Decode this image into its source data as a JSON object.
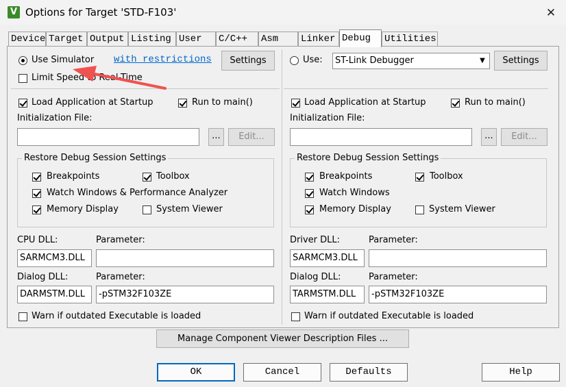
{
  "window": {
    "title": "Options for Target 'STD-F103'",
    "app_icon_letter": "V",
    "close_glyph": "✕"
  },
  "tabs": [
    "Device",
    "Target",
    "Output",
    "Listing",
    "User",
    "C/C++",
    "Asm",
    "Linker",
    "Debug",
    "Utilities"
  ],
  "active_tab": "Debug",
  "left": {
    "use_simulator": "Use Simulator",
    "restrictions_link": "with restrictions",
    "settings": "Settings",
    "limit_speed": "Limit Speed to Real-Time",
    "load_app": "Load Application at Startup",
    "run_to_main": "Run to main()",
    "init_file_label": "Initialization File:",
    "init_file_value": "",
    "browse": "...",
    "edit": "Edit...",
    "restore_group": "Restore Debug Session Settings",
    "breakpoints": "Breakpoints",
    "toolbox": "Toolbox",
    "watch": "Watch Windows & Performance Analyzer",
    "memory": "Memory Display",
    "system_viewer": "System Viewer",
    "cpu_dll_label": "CPU DLL:",
    "cpu_dll_value": "SARMCM3.DLL",
    "cpu_param_label": "Parameter:",
    "cpu_param_value": "",
    "dialog_dll_label": "Dialog DLL:",
    "dialog_dll_value": "DARMSTM.DLL",
    "dialog_param_label": "Parameter:",
    "dialog_param_value": "-pSTM32F103ZE",
    "warn": "Warn if outdated Executable is loaded"
  },
  "right": {
    "use": "Use:",
    "debugger": "ST-Link Debugger",
    "settings": "Settings",
    "load_app": "Load Application at Startup",
    "run_to_main": "Run to main()",
    "init_file_label": "Initialization File:",
    "init_file_value": "",
    "browse": "...",
    "edit": "Edit...",
    "restore_group": "Restore Debug Session Settings",
    "breakpoints": "Breakpoints",
    "toolbox": "Toolbox",
    "watch": "Watch Windows",
    "memory": "Memory Display",
    "system_viewer": "System Viewer",
    "driver_dll_label": "Driver DLL:",
    "driver_dll_value": "SARMCM3.DLL",
    "driver_param_label": "Parameter:",
    "driver_param_value": "",
    "dialog_dll_label": "Dialog DLL:",
    "dialog_dll_value": "TARMSTM.DLL",
    "dialog_param_label": "Parameter:",
    "dialog_param_value": "-pSTM32F103ZE",
    "warn": "Warn if outdated Executable is loaded"
  },
  "manage_button": "Manage Component Viewer Description Files ...",
  "footer": {
    "ok": "OK",
    "cancel": "Cancel",
    "defaults": "Defaults",
    "help": "Help"
  },
  "annotation": {
    "arrow_color": "#f0524f"
  }
}
